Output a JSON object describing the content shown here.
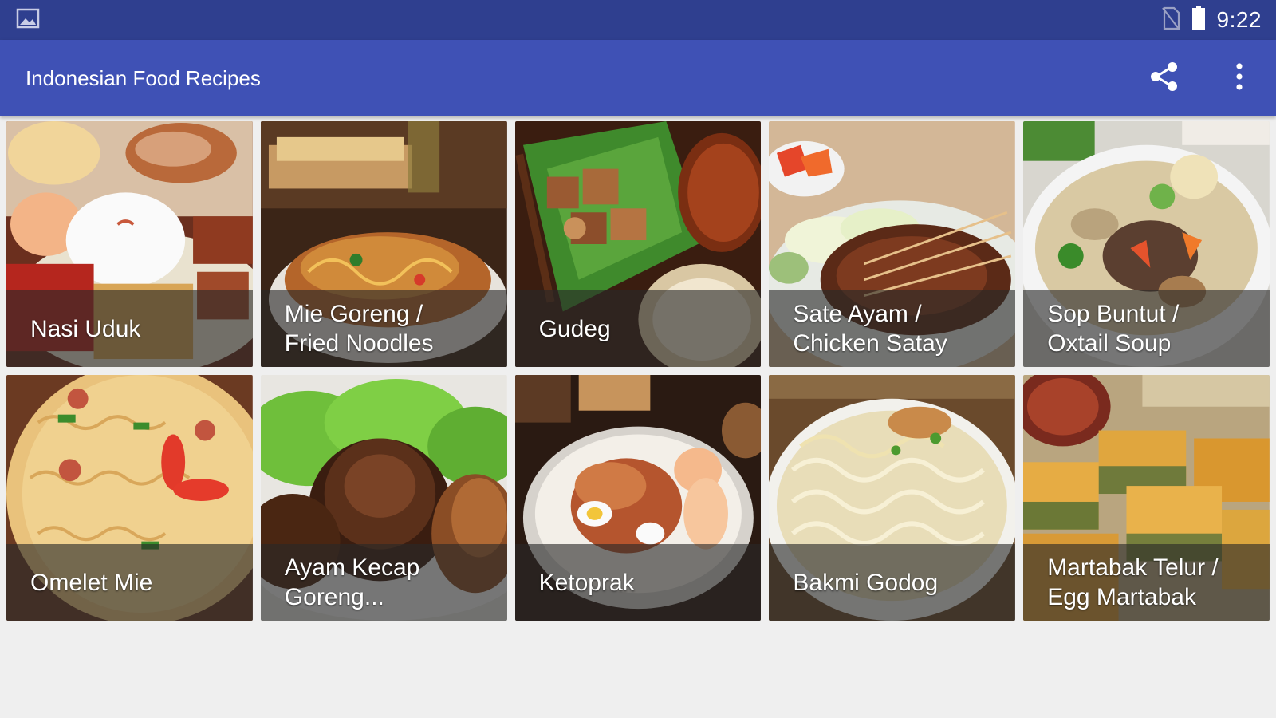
{
  "status_bar": {
    "time": "9:22",
    "icons": [
      "gallery-icon",
      "no-sim-icon",
      "battery-icon"
    ]
  },
  "app_bar": {
    "title": "Indonesian Food Recipes",
    "actions": [
      "share-icon",
      "more-vert-icon"
    ]
  },
  "colors": {
    "status_bar": "#2f3f8f",
    "app_bar": "#3f51b5",
    "background": "#efefef"
  },
  "recipes": [
    {
      "label": "Nasi Uduk"
    },
    {
      "label": "Mie Goreng /\nFried Noodles"
    },
    {
      "label": "Gudeg"
    },
    {
      "label": "Sate Ayam /\nChicken Satay"
    },
    {
      "label": "Sop Buntut /\nOxtail Soup"
    },
    {
      "label": "Omelet Mie"
    },
    {
      "label": "Ayam Kecap\nGoreng..."
    },
    {
      "label": "Ketoprak"
    },
    {
      "label": "Bakmi Godog"
    },
    {
      "label": "Martabak Telur /\nEgg Martabak"
    }
  ]
}
